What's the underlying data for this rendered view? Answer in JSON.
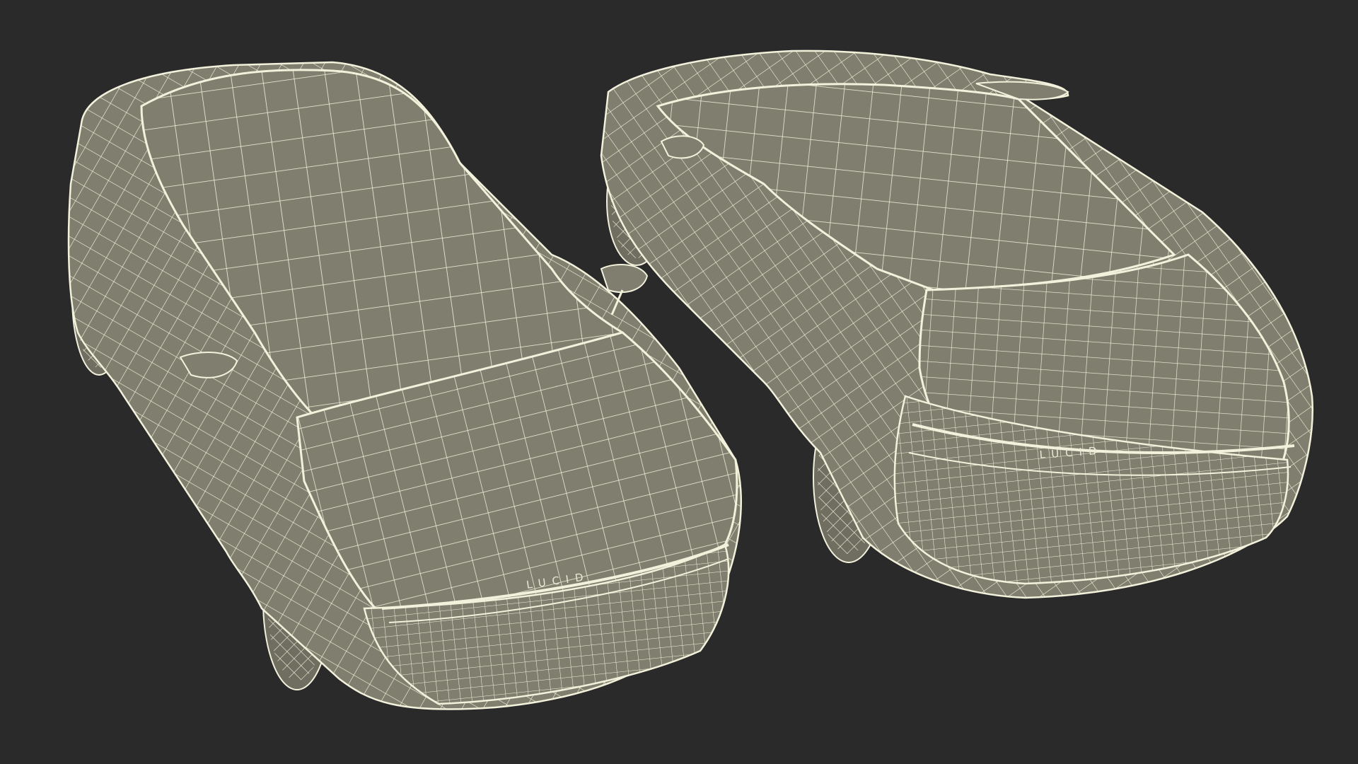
{
  "scene": {
    "background": "#2a2a2a",
    "mesh_fill": "#807f6f",
    "mesh_fill_dark": "#6f6e60",
    "wire_color": "#f2f1dc"
  },
  "models": [
    {
      "id": "front",
      "emblem": "LUCID"
    },
    {
      "id": "rear",
      "emblem": "LUCID"
    }
  ]
}
